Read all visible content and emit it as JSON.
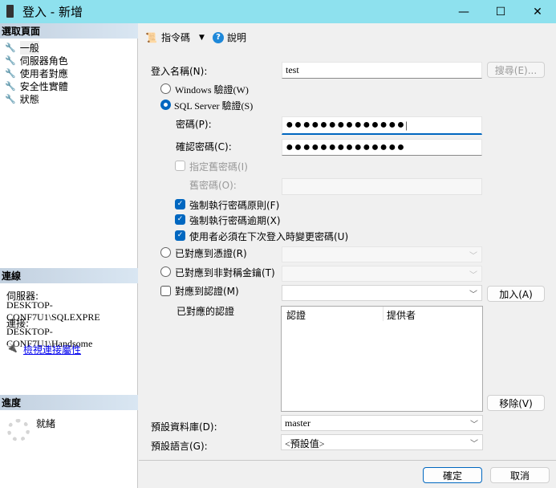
{
  "window": {
    "title": "登入 - 新增",
    "minimize": "—",
    "maximize": "☐",
    "close": "✕"
  },
  "left": {
    "select_page_header": "選取頁面",
    "pages": [
      {
        "label": "一般"
      },
      {
        "label": "伺服器角色"
      },
      {
        "label": "使用者對應"
      },
      {
        "label": "安全性實體"
      },
      {
        "label": "狀態"
      }
    ],
    "connection_header": "連線",
    "server_label": "伺服器:",
    "server_value": "DESKTOP-CONF7U1\\SQLEXPRE",
    "connection_label": "連接:",
    "connection_value": "DESKTOP-CONF7U1\\Handsome",
    "view_properties_link": "檢視連接屬性",
    "progress_header": "進度",
    "progress_status": "就緒"
  },
  "toolbar": {
    "script_label": "指令碼",
    "help_label": "說明"
  },
  "form": {
    "login_name_label": "登入名稱(N):",
    "login_name_value": "test",
    "search_button": "搜尋(E)...",
    "windows_auth": "Windows 驗證(W)",
    "sql_auth": "SQL Server 驗證(S)",
    "auth_selected": "sql",
    "password_label": "密碼(P):",
    "password_value": "●●●●●●●●●●●●●●",
    "confirm_label": "確認密碼(C):",
    "confirm_value": "●●●●●●●●●●●●●●",
    "specify_old_label": "指定舊密碼(I)",
    "specify_old_checked": false,
    "old_password_label": "舊密碼(O):",
    "enforce_policy_label": "強制執行密碼原則(F)",
    "enforce_policy_checked": true,
    "enforce_expiration_label": "強制執行密碼逾期(X)",
    "enforce_expiration_checked": true,
    "must_change_label": "使用者必須在下次登入時變更密碼(U)",
    "must_change_checked": true,
    "mapped_credential_label": "已對應到憑證(R)",
    "mapped_asym_key_label": "已對應到非對稱金鑰(T)",
    "map_credential_label": "對應到認證(M)",
    "map_credential_checked": false,
    "add_button": "加入(A)",
    "mapped_credentials_label": "已對應的認證",
    "credentials_columns": [
      "認證",
      "提供者"
    ],
    "remove_button": "移除(V)",
    "default_db_label": "預設資料庫(D):",
    "default_db_value": "master",
    "default_lang_label": "預設語言(G):",
    "default_lang_value": "<預設值>"
  },
  "footer": {
    "ok_button": "確定",
    "cancel_button": "取消"
  },
  "colors": {
    "titlebar": "#8ee1ee",
    "accent": "#0067c0"
  }
}
